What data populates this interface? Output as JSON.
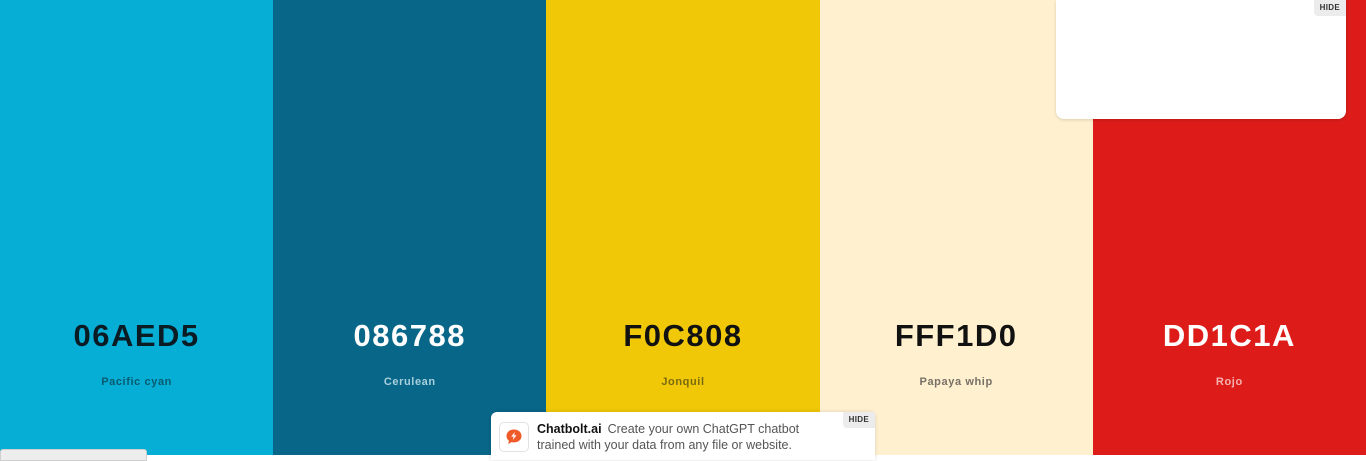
{
  "palette": {
    "swatches": [
      {
        "hex": "06AED5",
        "name": "Pacific cyan",
        "color": "#06AED5",
        "text_color": "#0b1b24",
        "name_color": "#0a5a70"
      },
      {
        "hex": "086788",
        "name": "Cerulean",
        "color": "#086788",
        "text_color": "#ffffff",
        "name_color": "#a8cfdc"
      },
      {
        "hex": "F0C808",
        "name": "Jonquil",
        "color": "#F0C808",
        "text_color": "#111111",
        "name_color": "#7a6a10"
      },
      {
        "hex": "FFF1D0",
        "name": "Papaya whip",
        "color": "#FFF1D0",
        "text_color": "#111111",
        "name_color": "#777066"
      },
      {
        "hex": "DD1C1A",
        "name": "Rojo",
        "color": "#DD1C1A",
        "text_color": "#ffffff",
        "name_color": "#f4b3b1"
      }
    ]
  },
  "ad_box": {
    "hide_label": "HIDE"
  },
  "chatbolt_ad": {
    "hide_label": "HIDE",
    "brand": "Chatbolt.ai",
    "line1": "Create your own ChatGPT chatbot",
    "line2": "trained with your data from any file or website.",
    "icon": "chatbolt-logo-icon",
    "icon_color": "#f05a28"
  }
}
